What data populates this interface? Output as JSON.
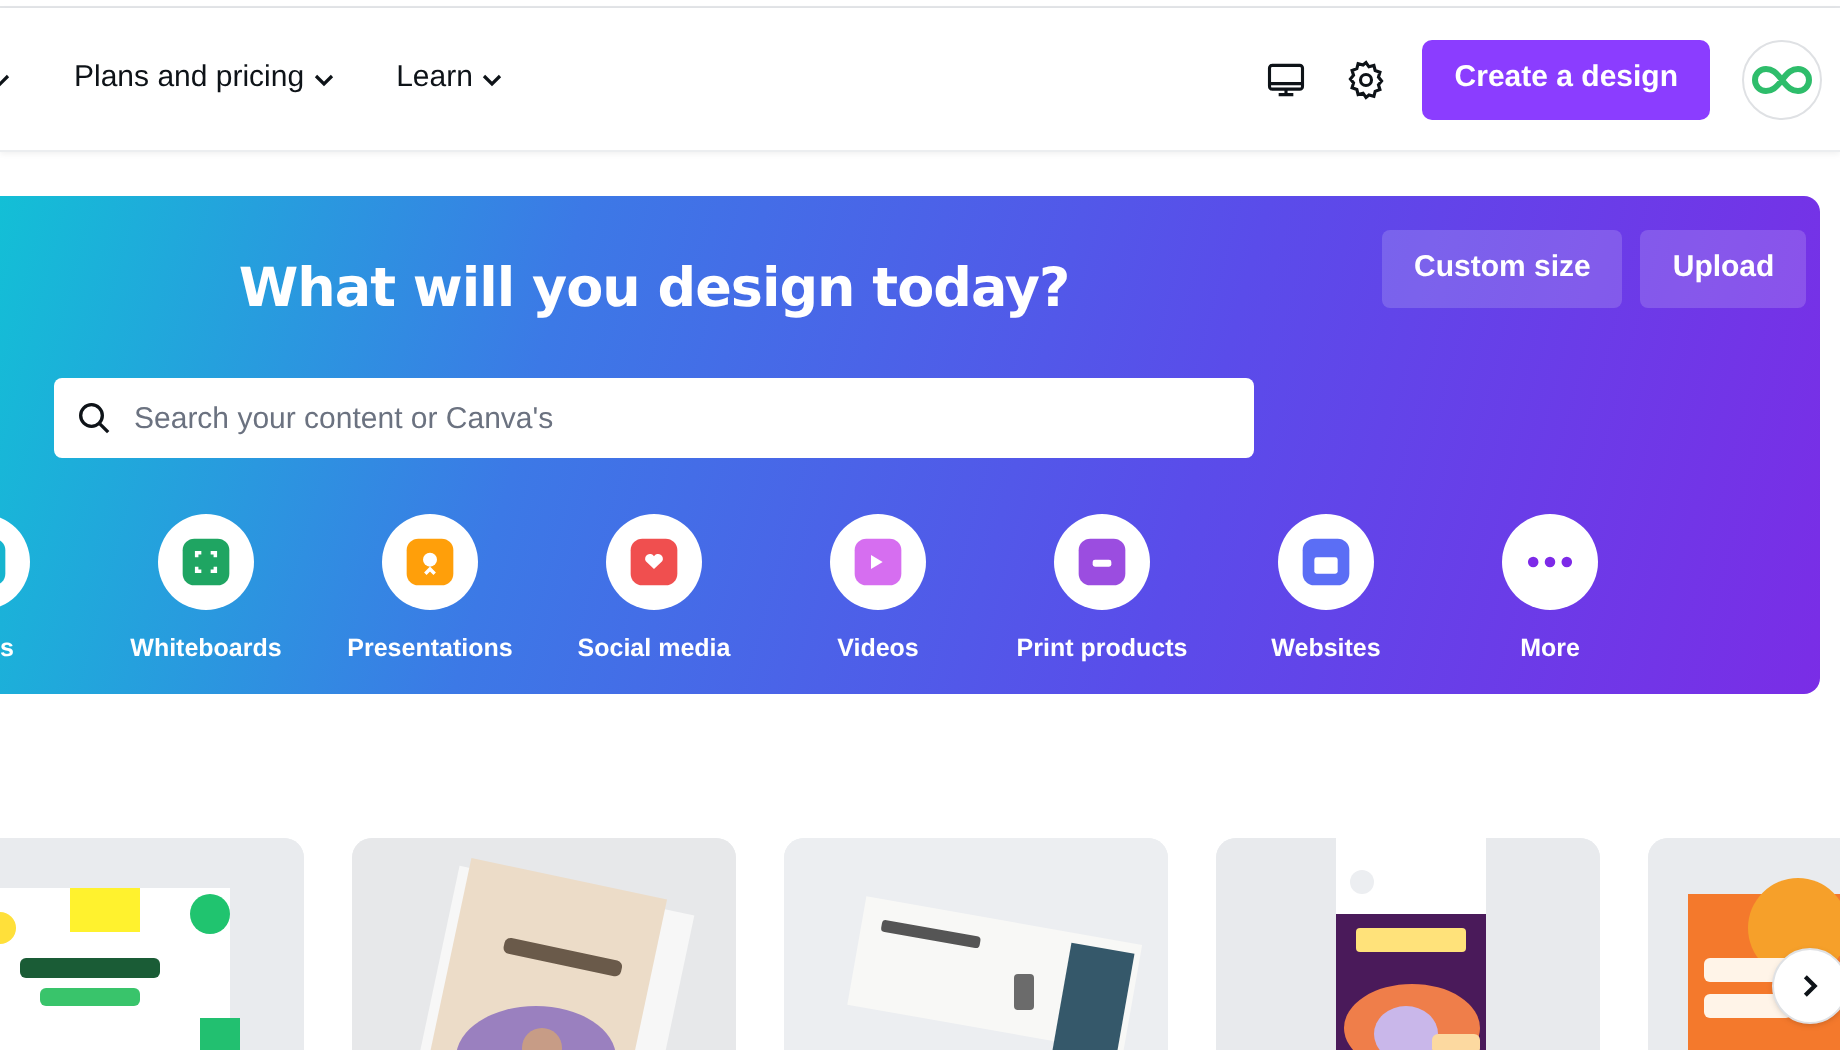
{
  "nav": [
    {
      "label": "Plans and pricing"
    },
    {
      "label": "Learn"
    }
  ],
  "header": {
    "create_button": "Create a design"
  },
  "hero": {
    "title": "What will you design today?",
    "buttons": [
      "Custom size",
      "Upload"
    ],
    "search": {
      "placeholder": "Search your content or Canva's"
    },
    "categories": [
      {
        "label": "s",
        "color": "#16b5cf"
      },
      {
        "label": "Whiteboards",
        "color": "#1fa562"
      },
      {
        "label": "Presentations",
        "color": "#ff9f0a"
      },
      {
        "label": "Social media",
        "color": "#f04f4f"
      },
      {
        "label": "Videos",
        "color": "#d66ef0"
      },
      {
        "label": "Print products",
        "color": "#9b4de0"
      },
      {
        "label": "Websites",
        "color": "#5b6ef5"
      },
      {
        "label": "More",
        "color": "#7d2ae8"
      }
    ]
  }
}
